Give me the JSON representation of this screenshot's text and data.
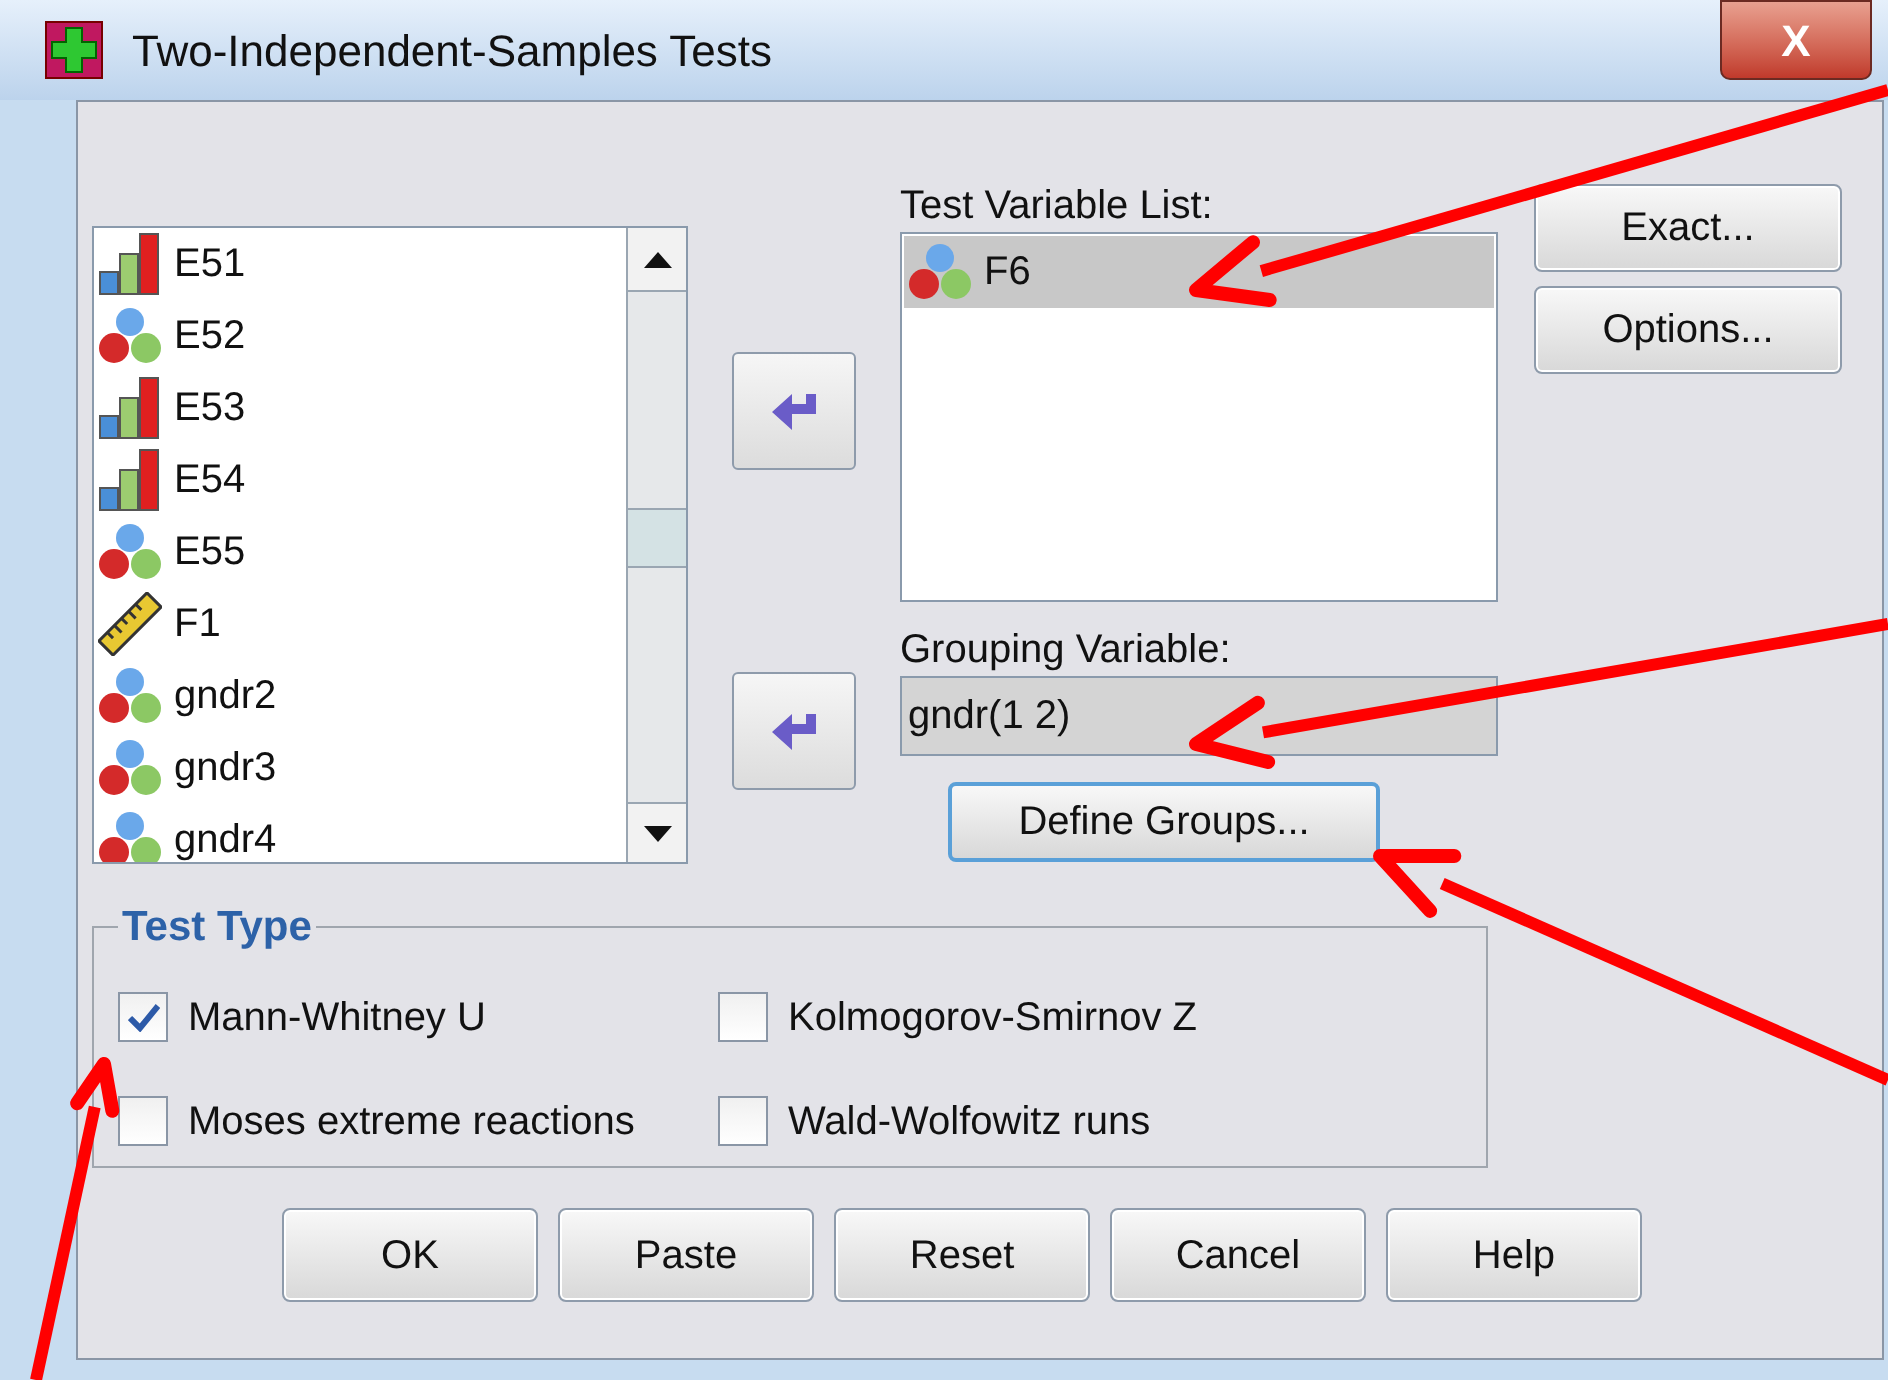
{
  "window": {
    "title": "Two-Independent-Samples Tests",
    "close": "X"
  },
  "variables": [
    {
      "name": "E51",
      "kind": "ordinal"
    },
    {
      "name": "E52",
      "kind": "nominal"
    },
    {
      "name": "E53",
      "kind": "ordinal"
    },
    {
      "name": "E54",
      "kind": "ordinal"
    },
    {
      "name": "E55",
      "kind": "nominal"
    },
    {
      "name": "F1",
      "kind": "scale"
    },
    {
      "name": "gndr2",
      "kind": "nominal"
    },
    {
      "name": "gndr3",
      "kind": "nominal"
    },
    {
      "name": "gndr4",
      "kind": "nominal"
    }
  ],
  "test_variable_list": {
    "label": "Test Variable List:",
    "items": [
      {
        "name": "F6",
        "kind": "nominal",
        "selected": true
      }
    ]
  },
  "grouping_variable": {
    "label": "Grouping Variable:",
    "value": "gndr(1 2)"
  },
  "define_groups": "Define Groups...",
  "side_buttons": [
    "Exact...",
    "Options..."
  ],
  "test_type": {
    "title": "Test Type",
    "options": [
      {
        "label": "Mann-Whitney U",
        "checked": true
      },
      {
        "label": "Kolmogorov-Smirnov Z",
        "checked": false
      },
      {
        "label": "Moses extreme reactions",
        "checked": false
      },
      {
        "label": "Wald-Wolfowitz runs",
        "checked": false
      }
    ]
  },
  "buttons": [
    "OK",
    "Paste",
    "Reset",
    "Cancel",
    "Help"
  ]
}
